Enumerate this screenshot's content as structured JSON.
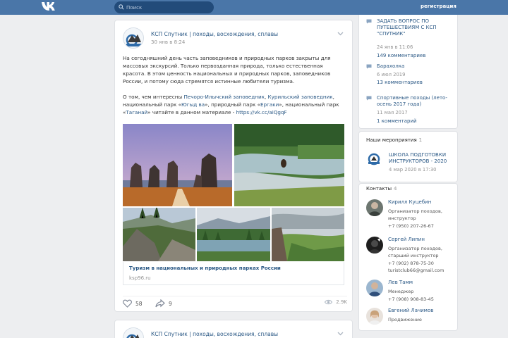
{
  "header": {
    "search_placeholder": "Поиск",
    "register_label": "регистрация"
  },
  "post": {
    "author": "КСП Спутник | походы, восхождения, сплавы",
    "date": "30 янв в 8:24",
    "paragraph1": "На сегодняшний день часть заповедников и природных парков закрыты для массовых экскурсий. Только первозданная природа, только естественная красота. В этом ценность национальных и природных парков, заповедников России, и потому сюда стремятся истинные любители туризма.",
    "p2_intro": "О том, чем интересны ",
    "p2_link1": "Печоро-Илычский заповедник",
    "p2_sep1": ", ",
    "p2_link2": "Курильский заповедник",
    "p2_mid1": ", национальный парк «",
    "p2_link3": "Югыд ва",
    "p2_mid2": "», природный парк «",
    "p2_link4": "Ергаки",
    "p2_mid3": "», национальный парк «",
    "p2_link5": "Таганай",
    "p2_mid4": "» читайте в данном материале - ",
    "p2_url": "https://vk.cc/aiQgqF",
    "link_title": "Туризм в национальных и природных парках России",
    "link_host": "ksp96.ru",
    "likes": "58",
    "shares": "9",
    "views": "2.9K"
  },
  "post2": {
    "author": "КСП Спутник | походы, восхождения, сплавы"
  },
  "topics": [
    {
      "title": "ЗАДАТЬ ВОПРОС ПО ПУТЕШЕСТВИЯМ С КСП \"СПУТНИК\"",
      "date": "24 янв в 11:06",
      "count": "149 комментариев"
    },
    {
      "title": "Барахолка",
      "date": "6 июл 2019",
      "count": "13 комментариев"
    },
    {
      "title": "Спортивные походы (лето-осень 2017 года)",
      "date": "11 мая 2017",
      "count": "1 комментарий"
    }
  ],
  "events": {
    "heading": "Наши мероприятия",
    "count": "1",
    "title": "ШКОЛА ПОДГОТОВКИ ИНСТРУКТОРОВ - 2020",
    "date": "4 мар 2020 в 17:30"
  },
  "contacts": {
    "heading": "Контакты",
    "count": "4",
    "people": [
      {
        "name": "Кирилл Куцебин",
        "role": "Организатор походов, инструктор",
        "phone": "+7 (950) 207-26-67",
        "extra": ""
      },
      {
        "name": "Сергей Липин",
        "role": "Организатор походов, старший инструктор",
        "phone": "+7 (902) 878-75-30",
        "extra": "turistclub66@gmail.com"
      },
      {
        "name": "Лев Тамм",
        "role": "Менеджер",
        "phone": "+7 (908) 908-83-45",
        "extra": ""
      },
      {
        "name": "Евгений Лачимов",
        "role": "Продвижение",
        "phone": "",
        "extra": ""
      }
    ]
  },
  "colors": {
    "header": "#4a76a8",
    "link": "#2a5885",
    "page_bg": "#edeef0"
  }
}
